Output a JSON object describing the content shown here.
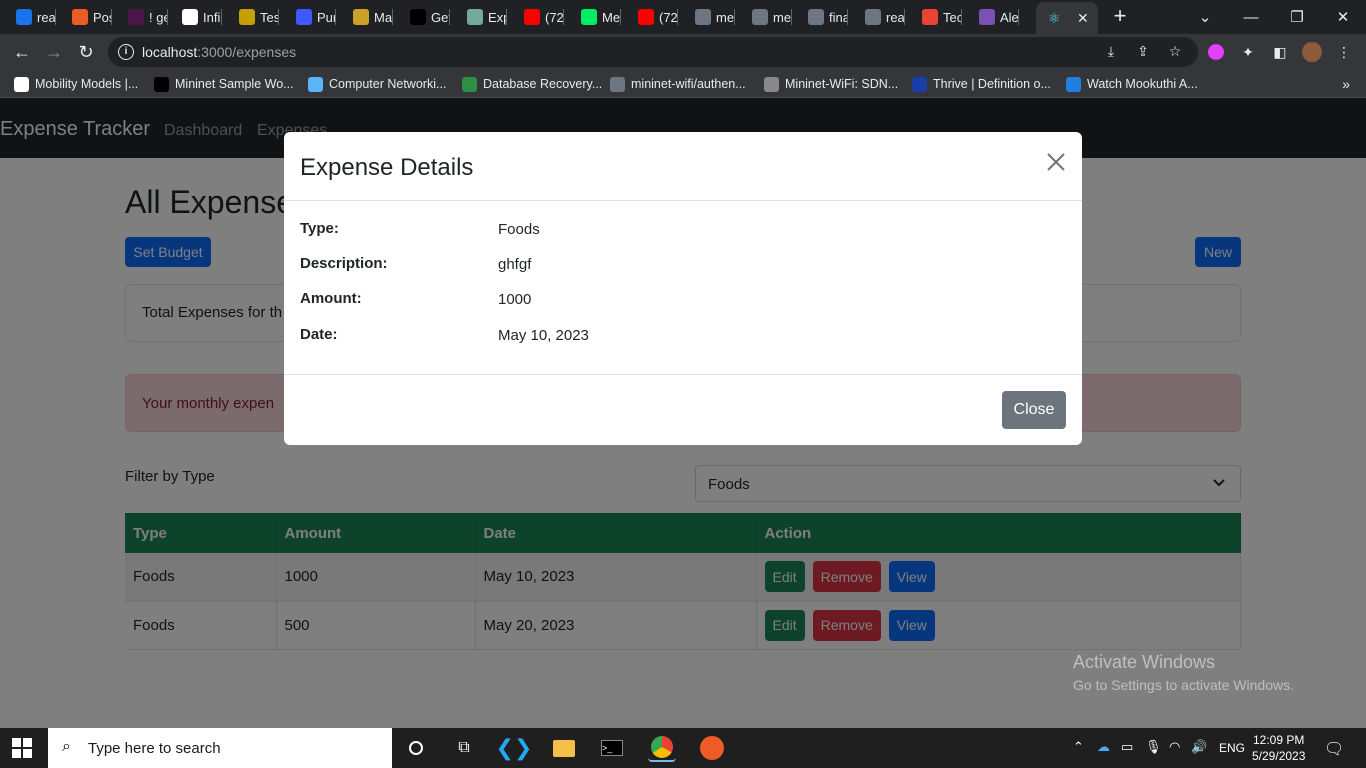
{
  "browser": {
    "tabs": [
      {
        "label": "real",
        "color": "#1a73e8",
        "icon": "bookmark-icon"
      },
      {
        "label": "Pos",
        "color": "#ef5b25",
        "icon": "postman-icon"
      },
      {
        "label": "! ge",
        "color": "#4a154b",
        "icon": "slack-icon"
      },
      {
        "label": "Infi",
        "color": "#ffffff",
        "icon": "doc-icon"
      },
      {
        "label": "Tes",
        "color": "#c5a000",
        "icon": "k-icon"
      },
      {
        "label": "Pur",
        "color": "#3d5afe",
        "icon": "b-icon"
      },
      {
        "label": "Ma",
        "color": "#c9a227",
        "icon": "coin-icon"
      },
      {
        "label": "Get",
        "color": "#000000",
        "icon": "nextjs-icon"
      },
      {
        "label": "Exp",
        "color": "#74aa9c",
        "icon": "chatgpt-icon"
      },
      {
        "label": "(72",
        "color": "#ff0000",
        "icon": "youtube-icon"
      },
      {
        "label": "Me",
        "color": "#00ed64",
        "icon": "mongodb-icon"
      },
      {
        "label": "(72",
        "color": "#ff0000",
        "icon": "youtube-icon"
      },
      {
        "label": "me",
        "color": "#6e7681",
        "icon": "github-icon"
      },
      {
        "label": "me",
        "color": "#6e7681",
        "icon": "github-icon"
      },
      {
        "label": "fina",
        "color": "#6e7681",
        "icon": "github-icon"
      },
      {
        "label": "rea",
        "color": "#6e7681",
        "icon": "github-icon"
      },
      {
        "label": "Tec",
        "color": "#ea4335",
        "icon": "gmail-icon"
      },
      {
        "label": "Ale",
        "color": "#7952b3",
        "icon": "bootstrap-icon"
      }
    ],
    "url_host": "localhost",
    "url_path": ":3000/expenses",
    "bookmarks": [
      {
        "label": "Mobility Models |...",
        "icon": "globe-icon"
      },
      {
        "label": "Mininet Sample Wo...",
        "icon": "medium-icon"
      },
      {
        "label": "Computer Networki...",
        "icon": "udemy-icon"
      },
      {
        "label": "Database Recovery...",
        "icon": "gfg-icon"
      },
      {
        "label": "mininet-wifi/authen...",
        "icon": "github-icon"
      },
      {
        "label": "Mininet-WiFi: SDN...",
        "icon": "researchgate-icon"
      },
      {
        "label": "Thrive | Definition o...",
        "icon": "dictionary-icon"
      },
      {
        "label": "Watch Mookuthi A...",
        "icon": "hotstar-icon"
      }
    ]
  },
  "app": {
    "brand": "Expense Tracker",
    "nav": [
      "Dashboard",
      "Expenses"
    ],
    "heading": "All Expenses",
    "set_budget_label": "Set Budget",
    "new_label": "New",
    "total_text": "Total Expenses for th",
    "alert_text": "Your monthly expen",
    "filter_label": "Filter by Type",
    "filter_value": "Foods",
    "table": {
      "headers": [
        "Type",
        "Amount",
        "Date",
        "Action"
      ],
      "rows": [
        {
          "type": "Foods",
          "amount": "1000",
          "date": "May 10, 2023"
        },
        {
          "type": "Foods",
          "amount": "500",
          "date": "May 20, 2023"
        }
      ],
      "actions": {
        "edit": "Edit",
        "remove": "Remove",
        "view": "View"
      }
    },
    "watermark_title": "Activate Windows",
    "watermark_sub": "Go to Settings to activate Windows."
  },
  "modal": {
    "title": "Expense Details",
    "fields": [
      {
        "label": "Type:",
        "value": "Foods"
      },
      {
        "label": "Description:",
        "value": "ghfgf"
      },
      {
        "label": "Amount:",
        "value": "1000"
      },
      {
        "label": "Date:",
        "value": "May 10, 2023"
      }
    ],
    "close_label": "Close"
  },
  "taskbar": {
    "search_placeholder": "Type here to search",
    "language": "ENG",
    "time": "12:09 PM",
    "date": "5/29/2023"
  }
}
